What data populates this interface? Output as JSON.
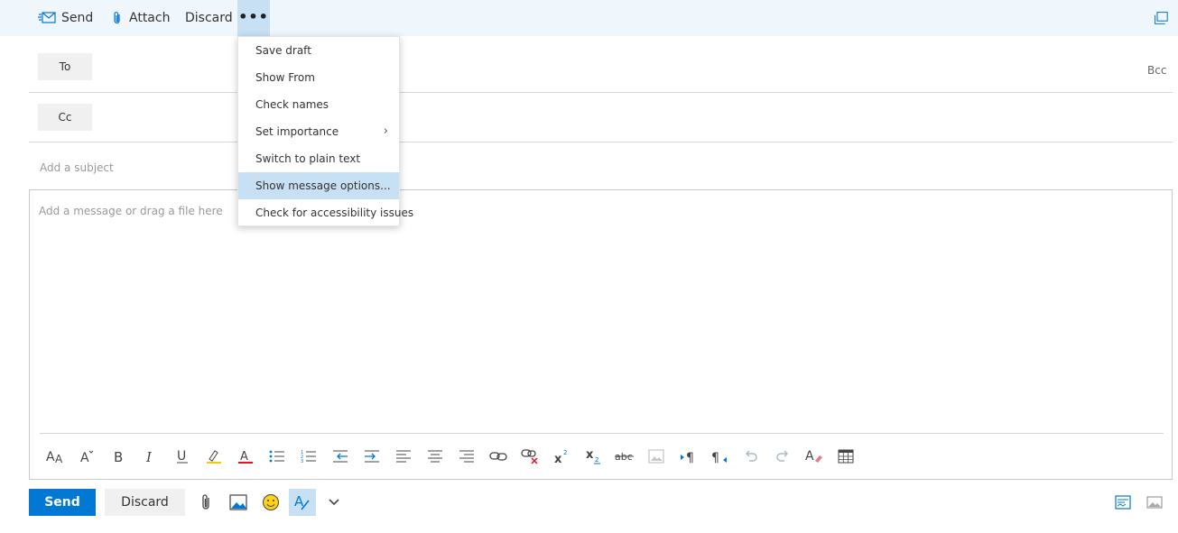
{
  "toolbar": {
    "send_label": "Send",
    "attach_label": "Attach",
    "discard_label": "Discard",
    "more_label": "•••",
    "popout_icon": "popout-icon"
  },
  "recipients": {
    "to_label": "To",
    "cc_label": "Cc",
    "bcc_label": "Bcc"
  },
  "subject": {
    "placeholder": "Add a subject"
  },
  "message": {
    "placeholder": "Add a message or drag a file here"
  },
  "more_menu": {
    "items": [
      {
        "label": "Save draft"
      },
      {
        "label": "Show From"
      },
      {
        "label": "Check names"
      },
      {
        "label": "Set importance",
        "has_submenu": true,
        "chevron": "›"
      },
      {
        "label": "Switch to plain text"
      },
      {
        "label": "Show message options...",
        "active": true
      },
      {
        "label": "Check for accessibility issues"
      }
    ]
  },
  "format_toolbar": [
    "font-size-icon",
    "grow-font-icon",
    "bold-icon",
    "italic-icon",
    "underline-icon",
    "highlight-icon",
    "font-color-icon",
    "bullets-icon",
    "numbering-icon",
    "decrease-indent-icon",
    "increase-indent-icon",
    "align-left-icon",
    "align-center-icon",
    "align-right-icon",
    "insert-link-icon",
    "remove-link-icon",
    "superscript-icon",
    "subscript-icon",
    "strikethrough-icon",
    "insert-picture-icon",
    "ltr-icon",
    "rtl-icon",
    "undo-icon",
    "redo-icon",
    "clear-formatting-icon",
    "table-icon"
  ],
  "bottom_bar": {
    "send_label": "Send",
    "discard_label": "Discard"
  },
  "colors": {
    "accent": "#0078d4",
    "toolbar_bg": "#eff6fc",
    "highlight": "#c7e0f4"
  }
}
